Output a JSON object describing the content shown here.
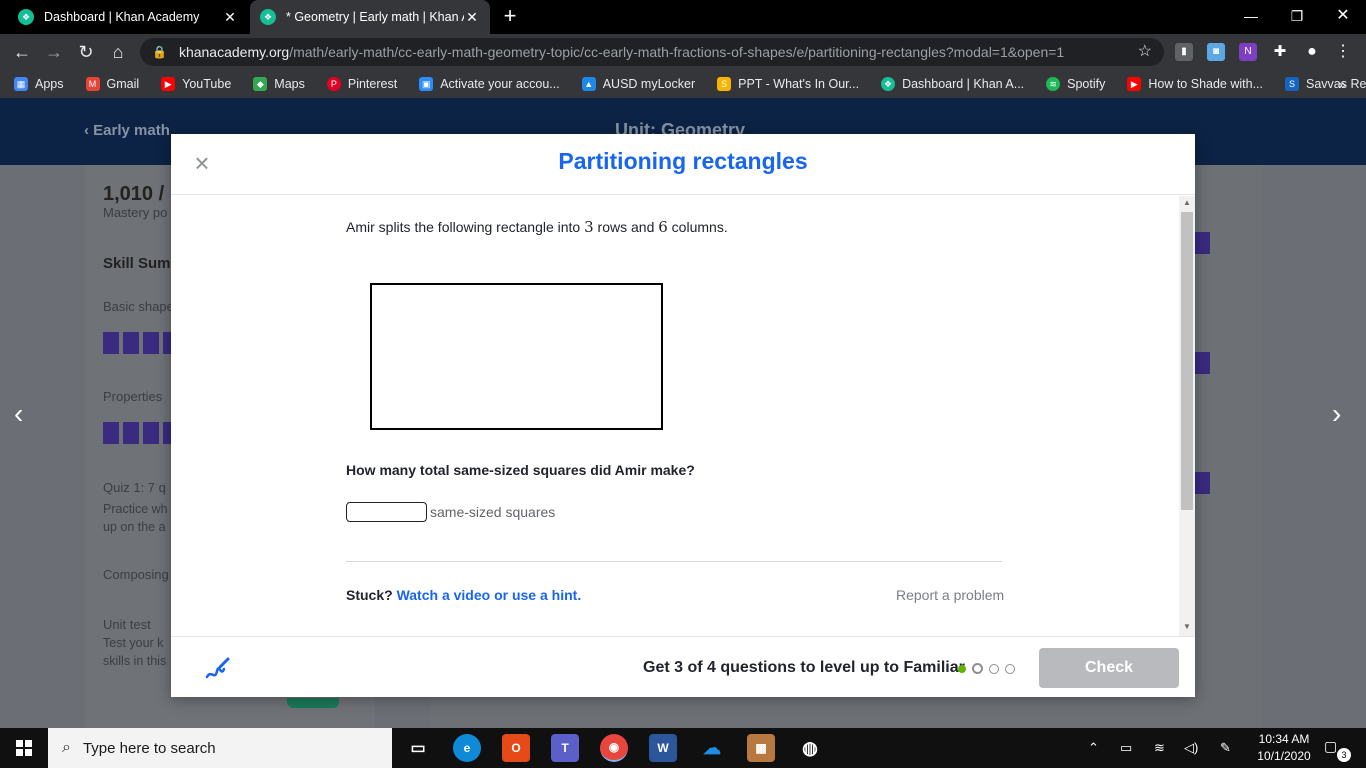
{
  "browser": {
    "tabs": [
      {
        "title": "Dashboard | Khan Academy"
      },
      {
        "title": "* Geometry | Early math | Khan Ac"
      }
    ],
    "address": {
      "domain": "khanacademy.org",
      "path": "/math/early-math/cc-early-math-geometry-topic/cc-early-math-fractions-of-shapes/e/partitioning-rectangles?modal=1&open=1"
    },
    "bookmarks": [
      {
        "label": "Apps",
        "color": "#4285f4"
      },
      {
        "label": "Gmail",
        "color": "#ea4335"
      },
      {
        "label": "YouTube",
        "color": "#ff0000"
      },
      {
        "label": "Maps",
        "color": "#34a853"
      },
      {
        "label": "Pinterest",
        "color": "#e60023"
      },
      {
        "label": "Activate your accou...",
        "color": "#2d8cff"
      },
      {
        "label": "AUSD myLocker",
        "color": "#1e88e5"
      },
      {
        "label": "PPT - What's In Our...",
        "color": "#f4b400"
      },
      {
        "label": "Dashboard | Khan A...",
        "color": "#14bf96"
      },
      {
        "label": "Spotify",
        "color": "#1db954"
      },
      {
        "label": "How to Shade with...",
        "color": "#ff0000"
      },
      {
        "label": "Savvas Realize",
        "color": "#1565c0"
      }
    ]
  },
  "background_page": {
    "back_link": "Early math",
    "unit_title": "Unit: Geometry",
    "mastery_points": "1,010 /",
    "mastery_label": "Mastery po",
    "skill_summary": "Skill Summ",
    "items": [
      "Basic shape",
      "Properties",
      "Quiz 1: 7 q",
      "Composing",
      "Unit test"
    ],
    "quiz_sub": [
      "Practice wh",
      "up on the a"
    ],
    "unit_test_sub": [
      "Test your k",
      "skills in this"
    ]
  },
  "modal": {
    "title": "Partitioning rectangles",
    "question_pre": "Amir splits the following rectangle into ",
    "rows": "3",
    "question_mid": " rows and ",
    "columns": "6",
    "question_post": " columns.",
    "prompt": "How many total same-sized squares did Amir make?",
    "answer_value": "",
    "answer_unit": "same-sized squares",
    "stuck_label": "Stuck?",
    "hint_link": "Watch a video or use a hint.",
    "report_link": "Report a problem",
    "progress_text": "Get 3 of 4 questions to level up to Familiar",
    "progress": {
      "completed": 1,
      "total": 4
    },
    "check_label": "Check",
    "colors": {
      "accent": "#1865f2",
      "progress_green": "#5fb400",
      "check_disabled": "#b8babe"
    }
  },
  "taskbar": {
    "search_placeholder": "Type here to search",
    "time": "10:34 AM",
    "date": "10/1/2020",
    "notification_count": "3"
  }
}
